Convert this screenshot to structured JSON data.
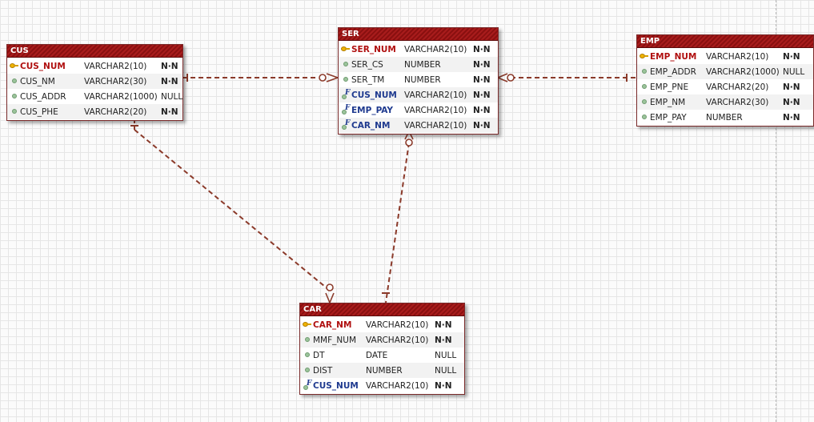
{
  "entities": {
    "cus": {
      "name": "CUS",
      "columns": [
        {
          "name": "CUS_NUM",
          "type": "VARCHAR2(10)",
          "nullable": "N·N",
          "role": "pk",
          "icon": "primary-key-icon"
        },
        {
          "name": "CUS_NM",
          "type": "VARCHAR2(30)",
          "nullable": "N·N",
          "role": "attr",
          "icon": "attribute-icon"
        },
        {
          "name": "CUS_ADDR",
          "type": "VARCHAR2(1000)",
          "nullable": "NULL",
          "role": "attr",
          "icon": "attribute-icon"
        },
        {
          "name": "CUS_PHE",
          "type": "VARCHAR2(20)",
          "nullable": "N·N",
          "role": "attr",
          "icon": "attribute-icon"
        }
      ]
    },
    "ser": {
      "name": "SER",
      "columns": [
        {
          "name": "SER_NUM",
          "type": "VARCHAR2(10)",
          "nullable": "N·N",
          "role": "pk",
          "icon": "primary-key-icon"
        },
        {
          "name": "SER_CS",
          "type": "NUMBER",
          "nullable": "N·N",
          "role": "attr",
          "icon": "attribute-icon"
        },
        {
          "name": "SER_TM",
          "type": "NUMBER",
          "nullable": "N·N",
          "role": "attr",
          "icon": "attribute-icon"
        },
        {
          "name": "CUS_NUM",
          "type": "VARCHAR2(10)",
          "nullable": "N·N",
          "role": "fk",
          "icon": "foreign-key-icon"
        },
        {
          "name": "EMP_PAY",
          "type": "VARCHAR2(10)",
          "nullable": "N·N",
          "role": "fk",
          "icon": "foreign-key-icon"
        },
        {
          "name": "CAR_NM",
          "type": "VARCHAR2(10)",
          "nullable": "N·N",
          "role": "fk",
          "icon": "foreign-key-icon"
        }
      ]
    },
    "emp": {
      "name": "EMP",
      "columns": [
        {
          "name": "EMP_NUM",
          "type": "VARCHAR2(10)",
          "nullable": "N·N",
          "role": "pk",
          "icon": "primary-key-icon"
        },
        {
          "name": "EMP_ADDR",
          "type": "VARCHAR2(1000)",
          "nullable": "NULL",
          "role": "attr",
          "icon": "attribute-icon"
        },
        {
          "name": "EMP_PNE",
          "type": "VARCHAR2(20)",
          "nullable": "N·N",
          "role": "attr",
          "icon": "attribute-icon"
        },
        {
          "name": "EMP_NM",
          "type": "VARCHAR2(30)",
          "nullable": "N·N",
          "role": "attr",
          "icon": "attribute-icon"
        },
        {
          "name": "EMP_PAY",
          "type": "NUMBER",
          "nullable": "N·N",
          "role": "attr",
          "icon": "attribute-icon"
        }
      ]
    },
    "car": {
      "name": "CAR",
      "columns": [
        {
          "name": "CAR_NM",
          "type": "VARCHAR2(10)",
          "nullable": "N·N",
          "role": "pk",
          "icon": "primary-key-icon"
        },
        {
          "name": "MMF_NUM",
          "type": "VARCHAR2(10)",
          "nullable": "N·N",
          "role": "attr",
          "icon": "attribute-icon"
        },
        {
          "name": "DT",
          "type": "DATE",
          "nullable": "NULL",
          "role": "attr",
          "icon": "attribute-icon"
        },
        {
          "name": "DIST",
          "type": "NUMBER",
          "nullable": "NULL",
          "role": "attr",
          "icon": "attribute-icon"
        },
        {
          "name": "CUS_NUM",
          "type": "VARCHAR2(10)",
          "nullable": "N·N",
          "role": "fk",
          "icon": "foreign-key-icon"
        }
      ]
    }
  },
  "relationships": [
    {
      "from": "CUS",
      "to": "SER",
      "from_end": "one",
      "to_end": "zero-or-many",
      "style": "dashed"
    },
    {
      "from": "EMP",
      "to": "SER",
      "from_end": "one",
      "to_end": "zero-or-many",
      "style": "dashed"
    },
    {
      "from": "CAR",
      "to": "SER",
      "from_end": "one",
      "to_end": "zero-or-many",
      "style": "dashed"
    },
    {
      "from": "CUS",
      "to": "CAR",
      "from_end": "one",
      "to_end": "zero-or-many",
      "style": "dashed"
    }
  ],
  "colors": {
    "header": "#9a1616",
    "pk_text": "#b01010",
    "fk_text": "#1f3a8f",
    "connector": "#8b3a2a"
  }
}
